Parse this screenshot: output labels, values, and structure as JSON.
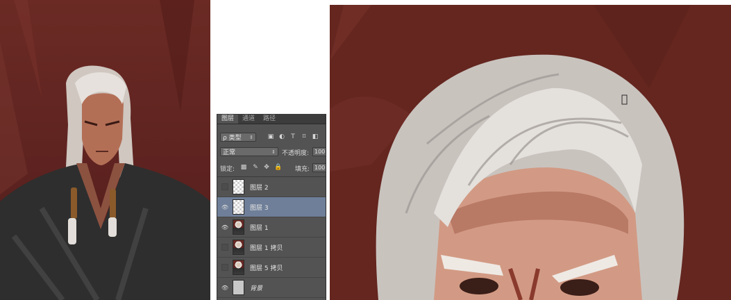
{
  "panel": {
    "tabs": [
      "图层",
      "通道",
      "路径"
    ],
    "filter": {
      "label": "ρ 类型"
    },
    "filter_icons": [
      "image-filter-icon",
      "adjustment-filter-icon",
      "text-filter-icon",
      "shape-filter-icon"
    ],
    "blend_mode": "正常",
    "opacity_label": "不透明度:",
    "opacity_value": "100",
    "lock_label": "锁定:",
    "lock_icons": [
      "lock-transparent-icon",
      "lock-paint-icon",
      "lock-move-icon",
      "lock-all-icon"
    ],
    "fill_label": "填充:",
    "fill_value": "100",
    "layers": [
      {
        "name": "图层 2",
        "visible": false,
        "thumb": "transparent",
        "selected": false
      },
      {
        "name": "图层 3",
        "visible": true,
        "thumb": "transparent",
        "selected": true
      },
      {
        "name": "图层 1",
        "visible": true,
        "thumb": "portrait",
        "selected": false
      },
      {
        "name": "图层 1 拷贝",
        "visible": false,
        "thumb": "portrait",
        "selected": false
      },
      {
        "name": "图层 5 拷贝",
        "visible": false,
        "thumb": "portrait",
        "selected": false
      },
      {
        "name": "背景",
        "visible": true,
        "thumb": "gray",
        "selected": false,
        "italic": true
      }
    ]
  },
  "colors": {
    "panel_bg": "#535353",
    "selected_row": "#6f7f99",
    "canvas_bg": "#64261f"
  }
}
